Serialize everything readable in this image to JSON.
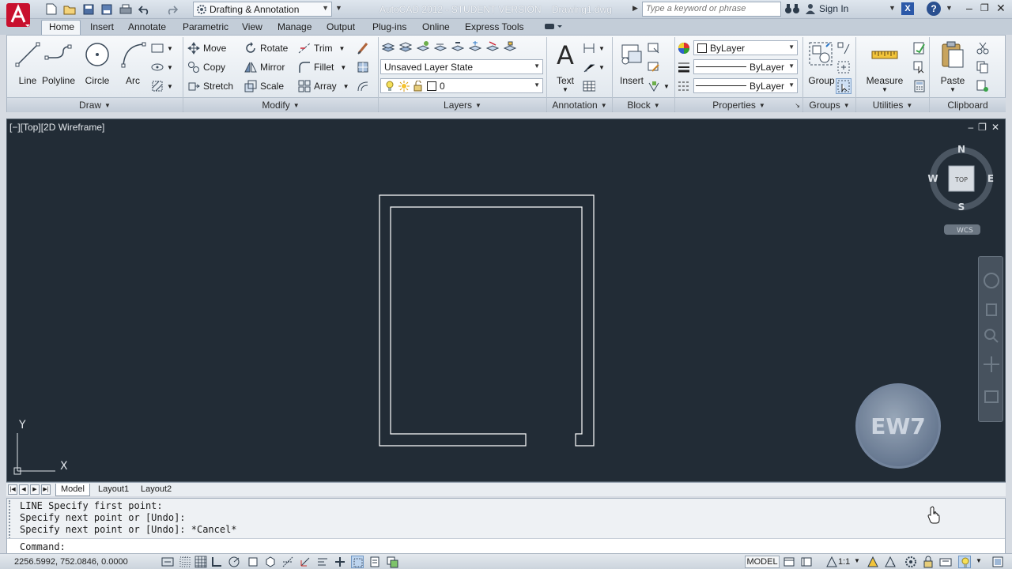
{
  "titlebar": {
    "workspace": "Drafting & Annotation",
    "app_name": "AutoCAD 2012 - STUDENT VERSION",
    "document": "Drawing1.dwg",
    "search_placeholder": "Type a keyword or phrase",
    "sign_in": "Sign In"
  },
  "ribbon_tabs": [
    "Home",
    "Insert",
    "Annotate",
    "Parametric",
    "View",
    "Manage",
    "Output",
    "Plug-ins",
    "Online",
    "Express Tools"
  ],
  "draw": {
    "line": "Line",
    "polyline": "Polyline",
    "circle": "Circle",
    "arc": "Arc",
    "panel": "Draw"
  },
  "modify": {
    "move": "Move",
    "rotate": "Rotate",
    "trim": "Trim",
    "copy": "Copy",
    "mirror": "Mirror",
    "fillet": "Fillet",
    "stretch": "Stretch",
    "scale": "Scale",
    "array": "Array",
    "panel": "Modify"
  },
  "layers": {
    "layer_state": "Unsaved Layer State",
    "current_layer": "0",
    "panel": "Layers"
  },
  "annotation": {
    "text": "Text",
    "panel": "Annotation"
  },
  "block": {
    "insert": "Insert",
    "panel": "Block"
  },
  "properties": {
    "color": "ByLayer",
    "lineweight": "ByLayer",
    "linetype": "ByLayer",
    "panel": "Properties"
  },
  "groups": {
    "group": "Group",
    "panel": "Groups"
  },
  "utilities": {
    "measure": "Measure",
    "panel": "Utilities"
  },
  "clipboard": {
    "paste": "Paste",
    "panel": "Clipboard"
  },
  "viewport": {
    "label": "[−][Top][2D Wireframe]",
    "viewcube": {
      "n": "N",
      "s": "S",
      "e": "E",
      "w": "W",
      "face": "TOP",
      "wcs": "WCS"
    },
    "ucs_y": "Y",
    "ucs_x": "X"
  },
  "watermark": "EW7",
  "layout_tabs": [
    "Model",
    "Layout1",
    "Layout2"
  ],
  "command": {
    "history": [
      "LINE Specify first point:",
      "Specify next point or [Undo]:",
      "Specify next point or [Undo]: *Cancel*"
    ],
    "prompt": "Command:"
  },
  "statusbar": {
    "coords": "2256.5992, 752.0846, 0.0000",
    "model": "MODEL",
    "scale": "1:1"
  }
}
